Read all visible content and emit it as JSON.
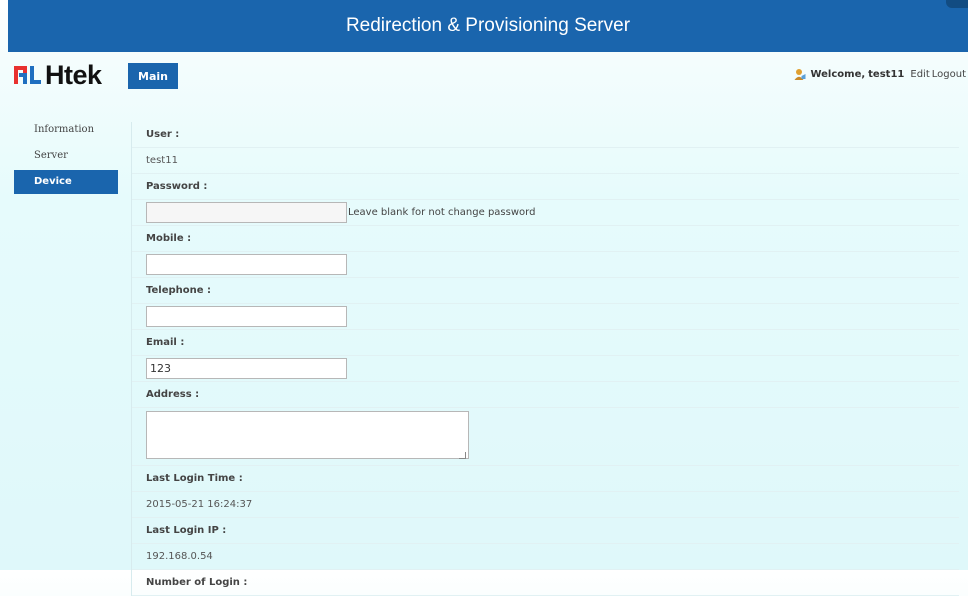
{
  "header": {
    "title": "Redirection & Provisioning Server"
  },
  "logo": {
    "text": "Htek"
  },
  "nav": {
    "main_tab": "Main"
  },
  "welcome": {
    "prefix": "Welcome,",
    "username": "test11",
    "edit_label": "Edit",
    "logout_label": "Logout"
  },
  "sidebar": {
    "items": [
      {
        "label": "Information",
        "active": false
      },
      {
        "label": "Server",
        "active": false
      },
      {
        "label": "Device",
        "active": true
      }
    ]
  },
  "form": {
    "user_label": "User :",
    "user_value": "test11",
    "password_label": "Password :",
    "password_value": "",
    "password_hint": "Leave blank for not change password",
    "mobile_label": "Mobile :",
    "mobile_value": "",
    "telephone_label": "Telephone :",
    "telephone_value": "",
    "email_label": "Email :",
    "email_value": "123",
    "address_label": "Address :",
    "address_value": "",
    "last_login_time_label": "Last Login Time :",
    "last_login_time_value": "2015-05-21 16:24:37",
    "last_login_ip_label": "Last Login IP :",
    "last_login_ip_value": "192.168.0.54",
    "number_of_login_label": "Number of Login :"
  },
  "colors": {
    "brand_blue": "#1a65ad",
    "logo_red": "#e8312f",
    "logo_blue": "#1f6fc0"
  }
}
